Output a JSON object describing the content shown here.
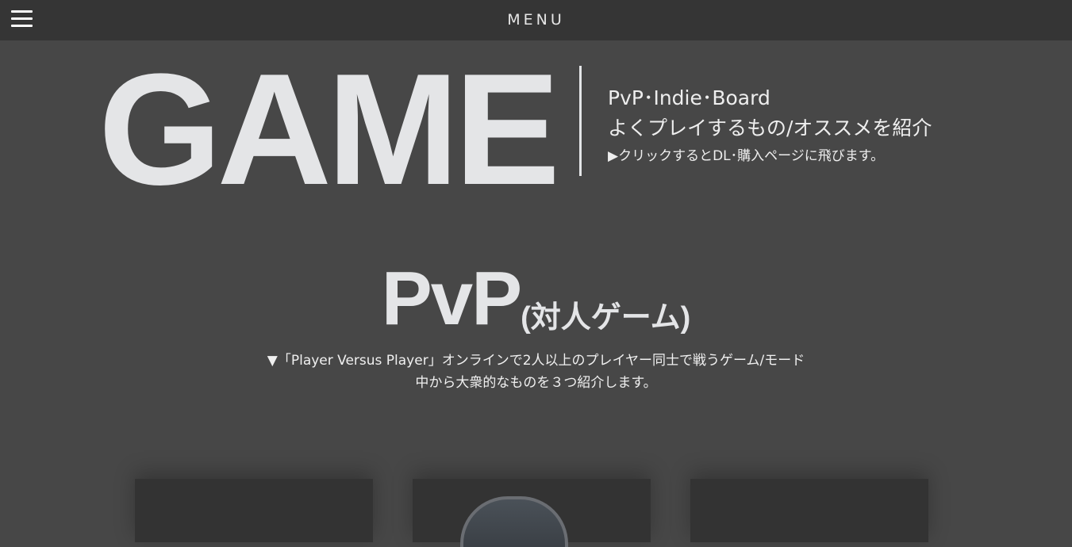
{
  "header": {
    "menu_label": "MENU",
    "menu_icon": "hamburger-icon"
  },
  "hero": {
    "title": "GAME",
    "sub_line1": "PvP･Indie･Board",
    "sub_line2": "よくプレイするもの/オススメを紹介",
    "sub_line3": "▶クリックするとDL･購入ページに飛びます。"
  },
  "section": {
    "title_main": "PvP",
    "title_sub": "(対人ゲーム)",
    "desc_line1": "▼「Player Versus Player」オンラインで2人以上のプレイヤー同士で戦うゲーム/モード",
    "desc_line2": "中から大衆的なものを３つ紹介します。"
  },
  "colors": {
    "background": "#474747",
    "topbar": "#353535",
    "text": "#e4e5e7",
    "card": "#333333"
  }
}
